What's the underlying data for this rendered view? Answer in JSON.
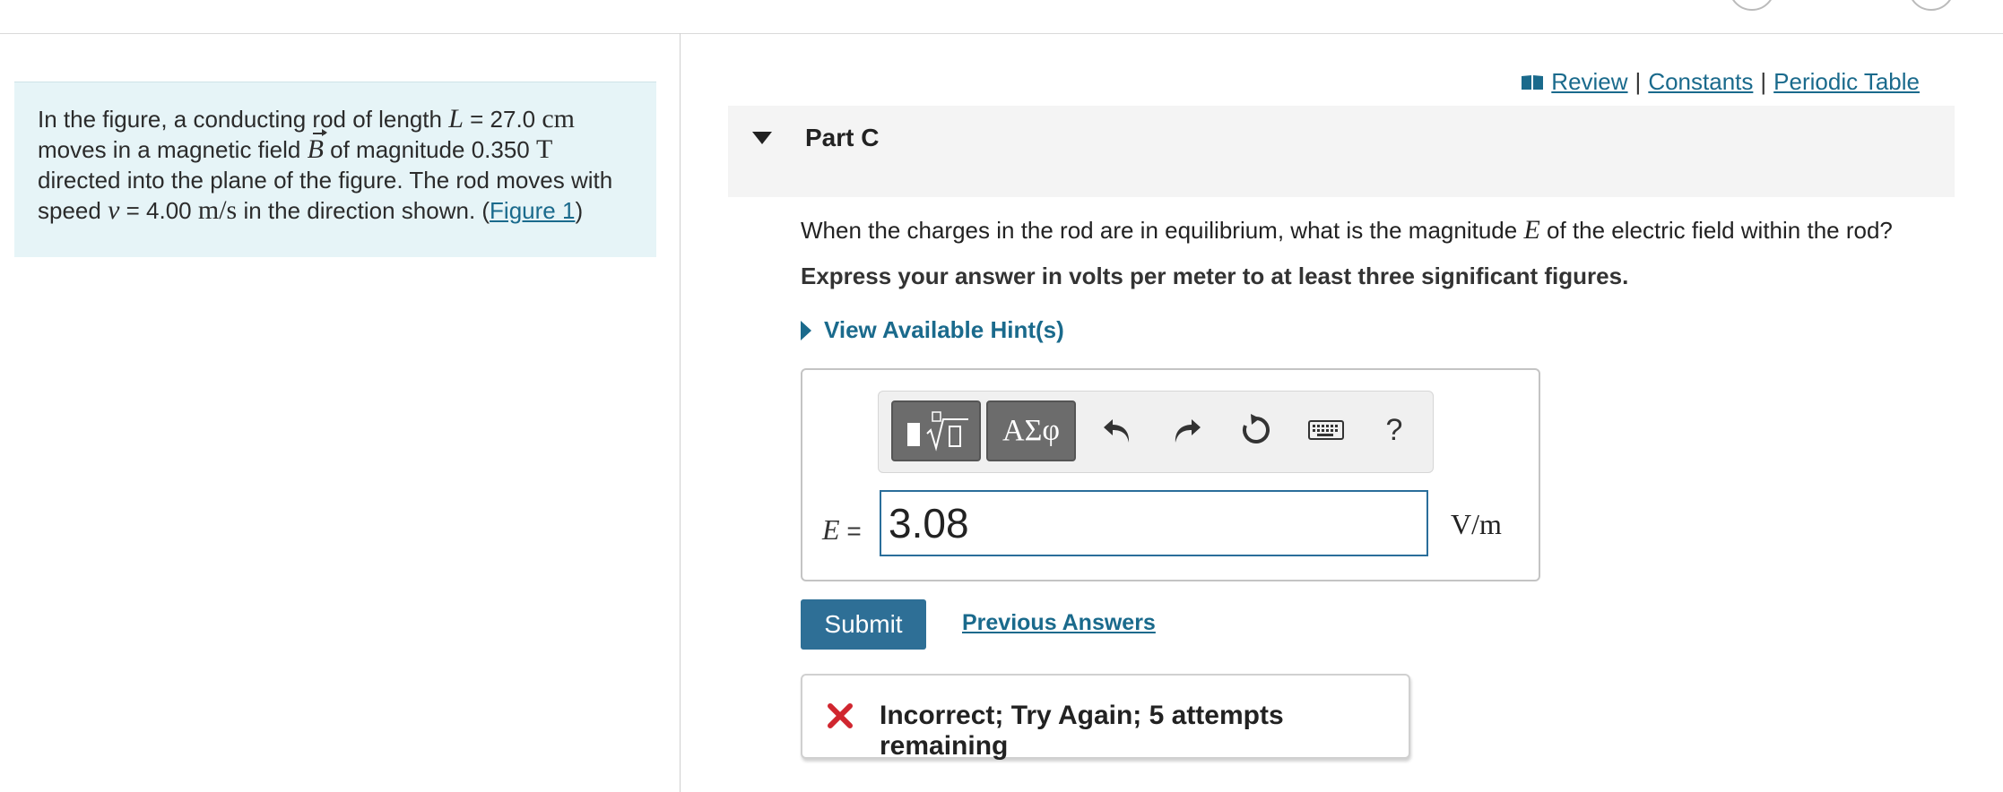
{
  "intro": {
    "t1": "In the figure, a conducting rod of length ",
    "var_L": "L",
    "eq1": " = 27.0 ",
    "unit_cm": "cm",
    "t2": "moves in a magnetic field ",
    "var_B": "B",
    "t3": " of magnitude 0.350 ",
    "unit_T": "T",
    "t4": "directed into the plane of the figure. The rod moves with",
    "t5": "speed ",
    "var_v": "v",
    "eq2": " = 4.00 ",
    "unit_ms": "m/s",
    "t6": " in the direction shown. (",
    "figure_link": "Figure 1",
    "t7": ")"
  },
  "resources": {
    "review": "Review",
    "constants": "Constants",
    "periodic": "Periodic Table",
    "sep": "|"
  },
  "part": {
    "title": "Part C"
  },
  "question": {
    "q1": "When the charges in the rod are in equilibrium, what is the magnitude ",
    "var_E": "E",
    "q2": " of the electric field within the rod?"
  },
  "instruction": "Express your answer in volts per meter to at least three significant figures.",
  "hint_label": "View Available Hint(s)",
  "toolbar": {
    "greek_label": "ΑΣφ",
    "help_label": "?"
  },
  "answer": {
    "var_label": "E",
    "equals": " =",
    "value": "3.08",
    "unit": "V/m"
  },
  "submit_label": "Submit",
  "previous_answers_label": "Previous Answers",
  "feedback": {
    "text": "Incorrect; Try Again; 5 attempts remaining",
    "icon": "x-icon"
  },
  "colors": {
    "accent": "#2e6f96",
    "link": "#1a6a8c",
    "intro_bg": "#e6f4f7",
    "error": "#d0262f"
  }
}
